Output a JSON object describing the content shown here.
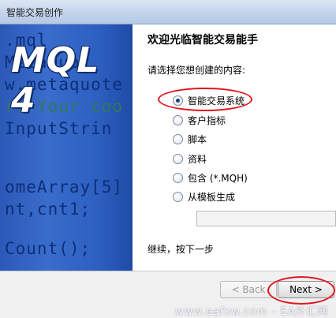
{
  "window": {
    "title": "智能交易创作"
  },
  "banner": {
    "logo_text": "MQL 4",
    "code_lines": [
      ".mql",
      "   MetaQuot",
      "w.metaquote",
      "rt Your coo",
      "  InputStrin",
      "",
      "omeArray[5]",
      "nt,cnt1;",
      "",
      "Count();"
    ]
  },
  "panel": {
    "heading": "欢迎光临智能交易能手",
    "prompt": "请选择您想创建的内容:",
    "options": [
      {
        "label": "智能交易系统",
        "checked": true
      },
      {
        "label": "客户指标",
        "checked": false
      },
      {
        "label": "脚本",
        "checked": false
      },
      {
        "label": "资料",
        "checked": false
      },
      {
        "label": "包含 (*.MQH)",
        "checked": false
      },
      {
        "label": "从模板生成",
        "checked": false
      }
    ],
    "template_value": "",
    "footer": "继续，按下一步"
  },
  "buttons": {
    "back_label": "< Back",
    "next_label": "Next >"
  },
  "watermark": "www.eafxw.com - EA外汇网",
  "colors": {
    "banner_blue": "#2f62c4",
    "annotation_red": "#e0161d",
    "panel_bg": "#ffffff"
  }
}
